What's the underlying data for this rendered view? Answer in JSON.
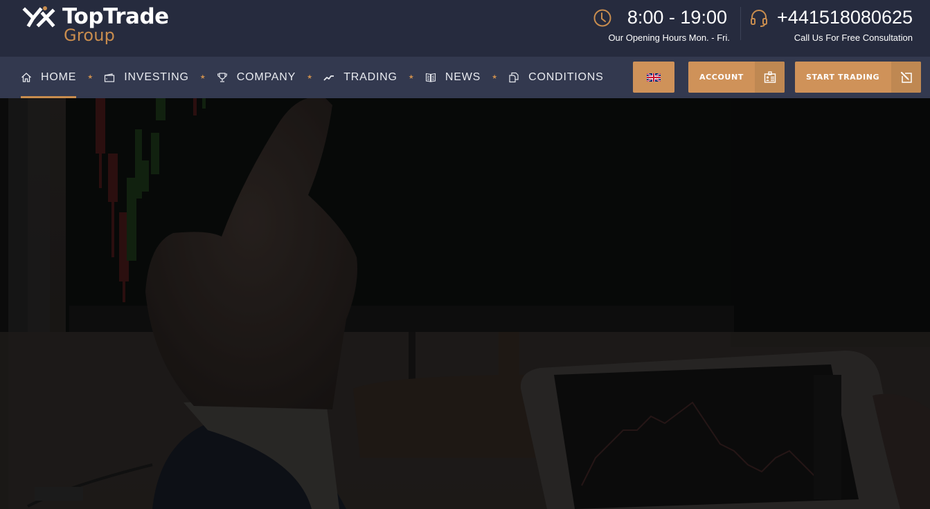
{
  "brand": {
    "name": "TopTrade",
    "subtitle": "Group",
    "accent_color": "#c98d4e",
    "logo_icon": "crossed-arrows-logo-icon"
  },
  "header": {
    "hours": {
      "icon": "clock-icon",
      "main": "8:00 - 19:00",
      "sub": "Our Opening Hours Mon. - Fri."
    },
    "phone": {
      "icon": "headset-icon",
      "main": "+441518080625",
      "sub": "Call Us For Free Consultation"
    }
  },
  "nav": {
    "items": [
      {
        "label": "HOME",
        "icon": "home-icon",
        "active": true
      },
      {
        "label": "INVESTING",
        "icon": "wallet-icon",
        "active": false
      },
      {
        "label": "COMPANY",
        "icon": "trophy-icon",
        "active": false
      },
      {
        "label": "TRADING",
        "icon": "trend-line-icon",
        "active": false
      },
      {
        "label": "NEWS",
        "icon": "newspaper-icon",
        "active": false
      },
      {
        "label": "CONDITIONS",
        "icon": "documents-icon",
        "active": false
      }
    ],
    "separator_icon": "star-icon"
  },
  "actions": {
    "language": {
      "icon": "uk-flag-icon",
      "label": "English"
    },
    "account": {
      "label": "ACCOUNT",
      "icon": "id-card-icon"
    },
    "start_trading": {
      "label": "START TRADING",
      "icon": "external-pencil-icon"
    }
  },
  "hero": {
    "description": "Darkened photo of a hand pointing at a trading monitor with candlestick chart, and a tablet showing a price chart"
  },
  "colors": {
    "topbar_bg": "#262b3e",
    "navbar_bg": "#33394f",
    "button_bg": "#cf9259",
    "button_icon_bg": "#bf8852",
    "text_light": "#ffffff"
  }
}
